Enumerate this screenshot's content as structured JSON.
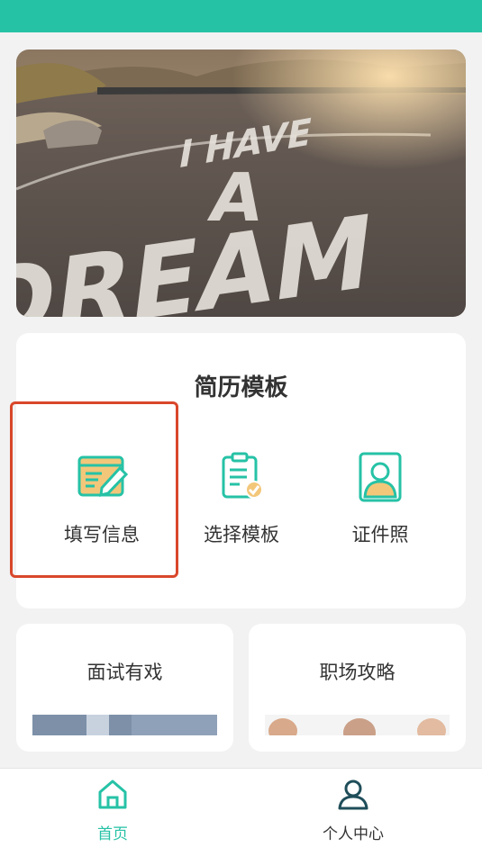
{
  "banner": {
    "text_line1": "I HAVE",
    "text_line2": "A",
    "text_line3": "DREAM"
  },
  "resume_card": {
    "title": "简历模板",
    "items": [
      {
        "label": "填写信息",
        "icon": "edit-form-icon"
      },
      {
        "label": "选择模板",
        "icon": "clipboard-check-icon"
      },
      {
        "label": "证件照",
        "icon": "id-photo-icon"
      }
    ]
  },
  "articles": [
    {
      "title": "面试有戏"
    },
    {
      "title": "职场攻略"
    }
  ],
  "tabbar": {
    "items": [
      {
        "label": "首页",
        "icon": "home-icon",
        "active": true
      },
      {
        "label": "个人中心",
        "icon": "user-icon",
        "active": false
      }
    ]
  },
  "colors": {
    "accent": "#26c2a6",
    "icon_fill": "#f3c77a",
    "highlight": "#d9472b",
    "tab_inactive": "#333333"
  }
}
